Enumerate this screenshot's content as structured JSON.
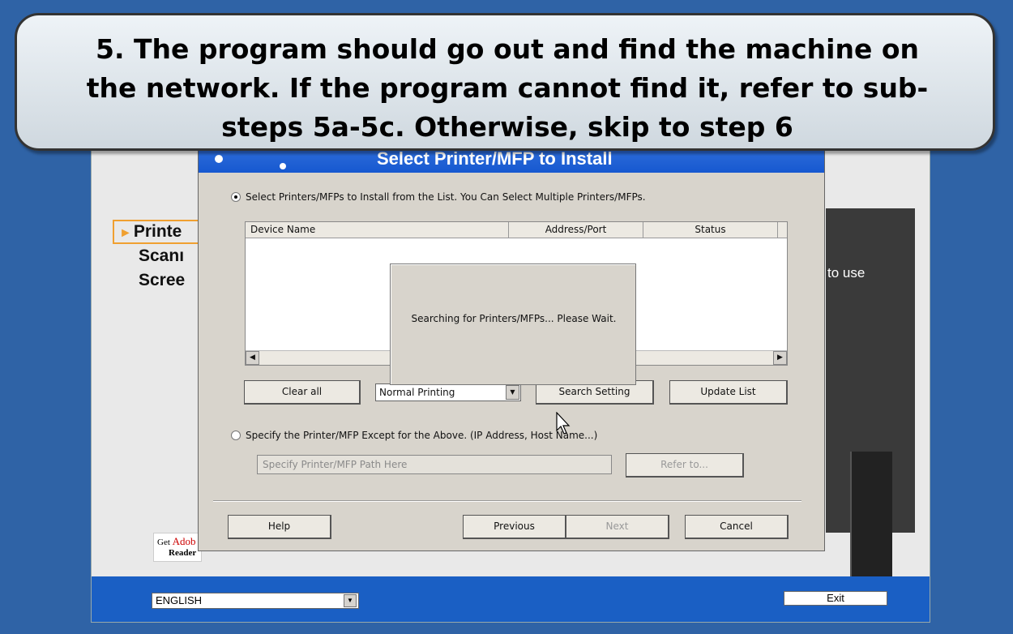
{
  "callout": {
    "line1": "5. The program should go out and find the machine on",
    "line2": "the network.  If the program cannot find it, refer to sub-",
    "line3": "steps 5a-5c.  Otherwise, skip to step 6"
  },
  "installer": {
    "side_items": [
      "Printe",
      "Scanı",
      "Scree"
    ],
    "right_text": "to use",
    "adobe_badge_get": "Get",
    "adobe_badge_brand": "Adob",
    "adobe_badge_reader": "Reader",
    "adobe_text": "Get Adobe Reader here.",
    "language": "ENGLISH",
    "exit_label": "Exit"
  },
  "dialog": {
    "title": "Select Printer/MFP to Install",
    "option_list_label": "Select Printers/MFPs to Install from the List. You Can Select Multiple Printers/MFPs.",
    "columns": [
      "Device Name",
      "Address/Port",
      "Status"
    ],
    "searching_message": "Searching for Printers/MFPs... Please Wait.",
    "clear_all": "Clear all",
    "printing_mode": "Normal Printing",
    "search_setting": "Search Setting",
    "update_list": "Update List",
    "option_specify_label": "Specify the Printer/MFP Except for the Above. (IP Address, Host Name...)",
    "path_placeholder": "Specify Printer/MFP Path Here",
    "refer_to": "Refer to...",
    "help": "Help",
    "previous": "Previous",
    "next": "Next",
    "cancel": "Cancel"
  },
  "colors": {
    "background": "#2f63a6",
    "title_bar": "#1658d0",
    "bottom_bar": "#1a5fc4",
    "highlight": "#f0a030"
  }
}
